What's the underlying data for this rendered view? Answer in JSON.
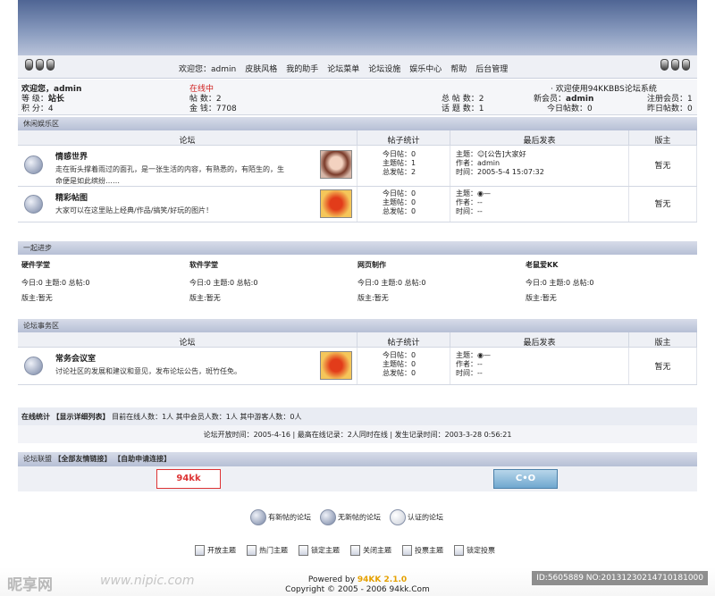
{
  "nav": {
    "welcome": "欢迎您：admin",
    "links": [
      "皮肤风格",
      "我的助手",
      "论坛菜单",
      "论坛设施",
      "娱乐中心",
      "帮助",
      "后台管理"
    ]
  },
  "user": {
    "welcome": "欢迎您，admin",
    "online": "在线中",
    "grade_label": "等 级：",
    "grade": "站长",
    "score": "积 分：4",
    "posts": "帖 数：2",
    "money": "金 钱：7708"
  },
  "stats": {
    "total_posts": "总 帖 数：2",
    "topics": "话 题 数：1",
    "new_member_label": "新会员：",
    "new_member": "admin",
    "today_posts": "今日帖数：0",
    "welcome_sys": "· 欢迎使用94KKBBS论坛系统",
    "registered": "注册会员：1",
    "yesterday": "昨日帖数：0"
  },
  "sections": [
    {
      "title": "休闲娱乐区",
      "headers": [
        "论坛",
        "帖子统计",
        "最后发表",
        "版主"
      ],
      "forums": [
        {
          "name": "情感世界",
          "desc": "走在街头撑着雨过的面孔，是一张生活的内容，有熟悉的，有陌生的，生命便是如此缤纷……",
          "today": "今日帖：0",
          "topics": "主题帖：1",
          "total": "总发帖：2",
          "last_topic": "主题：☺[公告]大家好",
          "last_author": "作者：admin",
          "last_time": "时间：2005-5-4 15:07:32",
          "moderator": "暂无"
        },
        {
          "name": "精彩帖图",
          "desc": "大家可以在这里贴上经典/作品/搞笑/好玩的图片！",
          "today": "今日帖：0",
          "topics": "主题帖：0",
          "total": "总发帖：0",
          "last_topic": "主题：◉—",
          "last_author": "作者：--",
          "last_time": "时间：--",
          "moderator": "暂无"
        }
      ]
    },
    {
      "title": "论坛事务区",
      "headers": [
        "论坛",
        "帖子统计",
        "最后发表",
        "版主"
      ],
      "forums": [
        {
          "name": "常务会议室",
          "desc": "讨论社区的发展和建议和意见，发布论坛公告，斑竹任免。",
          "today": "今日帖：0",
          "topics": "主题帖：0",
          "total": "总发帖：0",
          "last_topic": "主题：◉—",
          "last_author": "作者：--",
          "last_time": "时间：--",
          "moderator": "暂无"
        }
      ]
    }
  ],
  "tech": {
    "title": "一起进步",
    "boards": [
      {
        "name": "硬件学堂",
        "counts": "今日:0 主题:0 总帖:0",
        "mod": "版主:暂无"
      },
      {
        "name": "软件学堂",
        "counts": "今日:0 主题:0 总帖:0",
        "mod": "版主:暂无"
      },
      {
        "name": "网页制作",
        "counts": "今日:0 主题:0 总帖:0",
        "mod": "版主:暂无"
      },
      {
        "name": "老鼠爱KK",
        "counts": "今日:0 主题:0 总帖:0",
        "mod": "版主:暂无"
      }
    ]
  },
  "online": {
    "label": "在线统计",
    "detail_link": "【显示详细列表】",
    "text": "目前在线人数：1人 其中会员人数：1人 其中游客人数：0人",
    "history": "论坛开放时间：2005-4-16 | 最高在线记录：2人同时在线 | 发生记录时间：2003-3-28 0:56:21"
  },
  "links": {
    "label": "论坛联盟",
    "all_links": "【全部友情链接】",
    "apply": "【自助申请连接】"
  },
  "legend": [
    "有新帖的论坛",
    "无新帖的论坛",
    "认证的论坛"
  ],
  "topic_icons": [
    "开放主题",
    "热门主题",
    "锁定主题",
    "关闭主题",
    "投票主题",
    "锁定投票"
  ],
  "footer": {
    "powered_prefix": "Powered by",
    "brand": "94KK 2.1.0",
    "copyright": "Copyright © 2005 - 2006 94kk.Com"
  },
  "watermark": {
    "site": "昵享网",
    "url": "www.nipic.com",
    "id": "ID:5605889 NO:20131230214710181000"
  },
  "colors": {
    "banner": "#6b7fa8",
    "section_header": "#c3cade",
    "accent_red": "#d0201f",
    "brand_orange": "#e5a000"
  }
}
